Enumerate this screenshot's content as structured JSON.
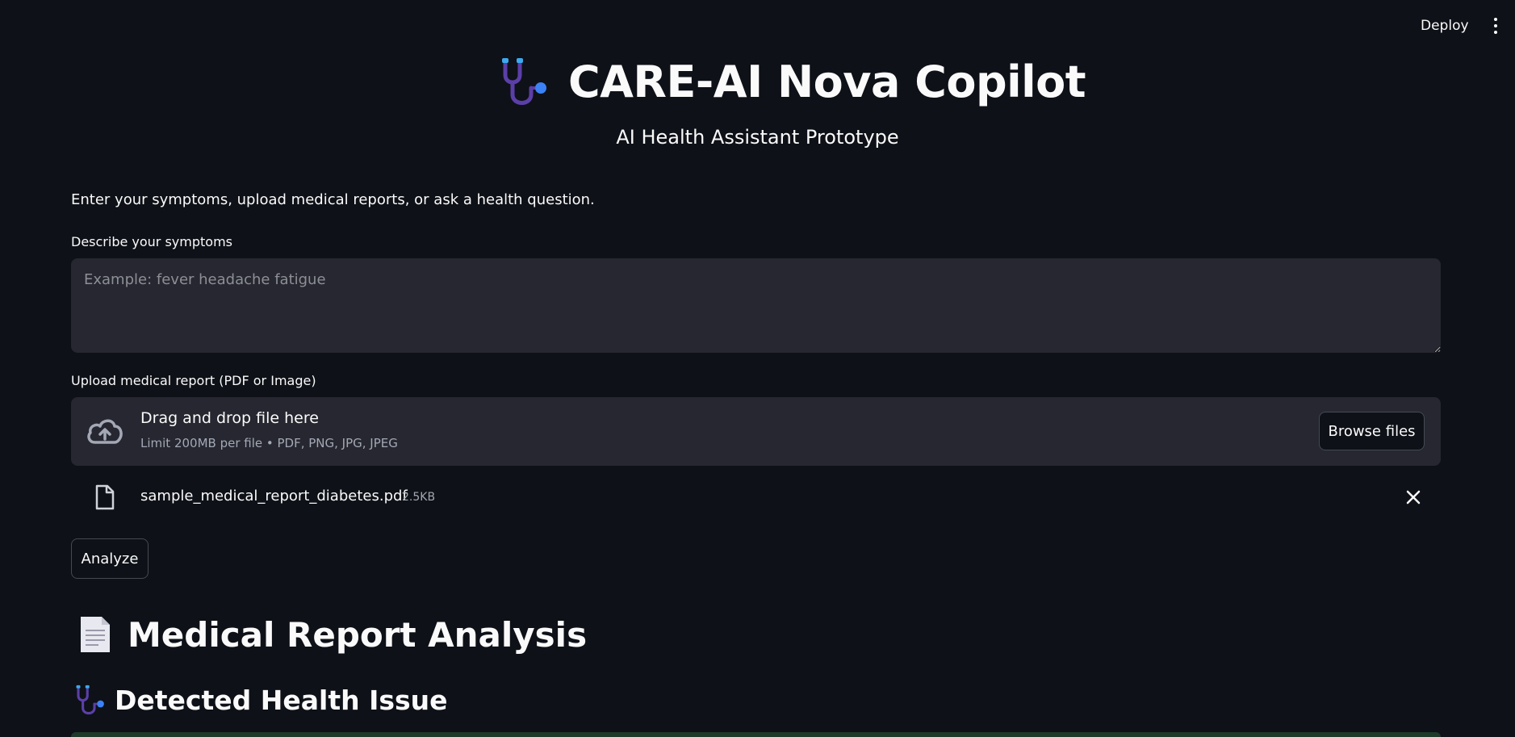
{
  "header": {
    "deploy_label": "Deploy",
    "menu_icon": "kebab-menu-icon"
  },
  "hero": {
    "icon": "stethoscope-icon",
    "title": "CARE-AI Nova Copilot",
    "subtitle": "AI Health Assistant Prototype"
  },
  "intro_text": "Enter your symptoms, upload medical reports, or ask a health question.",
  "symptoms": {
    "label": "Describe your symptoms",
    "placeholder": "Example: fever headache fatigue",
    "value": ""
  },
  "upload": {
    "label": "Upload medical report (PDF or Image)",
    "icon": "cloud-upload-icon",
    "drop_title": "Drag and drop file here",
    "limit_text": "Limit 200MB per file • PDF, PNG, JPG, JPEG",
    "browse_label": "Browse files",
    "file": {
      "icon": "file-icon",
      "name": "sample_medical_report_diabetes.pdf",
      "size": "2.5KB"
    }
  },
  "analyze_label": "Analyze",
  "report_section": {
    "icon": "document-icon",
    "title": "Medical Report Analysis"
  },
  "issue_section": {
    "icon": "stethoscope-icon",
    "title": "Detected Health Issue"
  },
  "colors": {
    "background": "#0e1117",
    "input_bg": "#262730",
    "text": "#fafafa",
    "muted": "#a3a8b4",
    "stethoscope_purple": "#5b3fa8",
    "stethoscope_blue": "#3b82f6"
  }
}
